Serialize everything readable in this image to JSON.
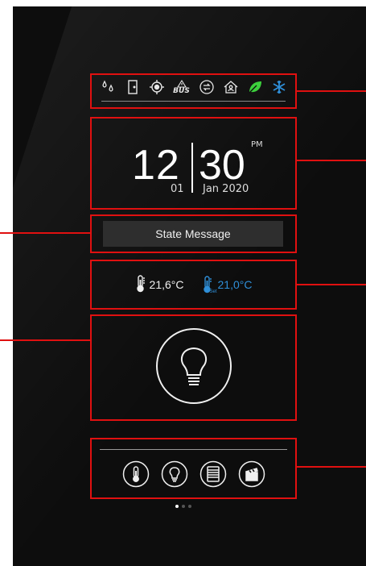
{
  "status_bar": {
    "icons": [
      "droplets-icon",
      "door-icon",
      "target-icon",
      "bus-warning-icon",
      "sync-icon",
      "home-person-icon",
      "leaf-icon",
      "snowflake-icon"
    ],
    "bus_label": "BUS",
    "leaf_color": "#3ccf3c",
    "snow_color": "#2f8fd8"
  },
  "clock": {
    "hours": "12",
    "minutes": "30",
    "ampm": "PM",
    "day": "01",
    "month_year": "Jan 2020"
  },
  "state": {
    "label": "State Message"
  },
  "temperature": {
    "current": "21,6°C",
    "setpoint": "21,0°C",
    "set_label": "Set",
    "setpoint_color": "#2f8fd8"
  },
  "light": {
    "icon": "lightbulb-icon"
  },
  "nav": {
    "items": [
      "thermometer-nav-icon",
      "lightbulb-nav-icon",
      "blinds-nav-icon",
      "scene-nav-icon"
    ],
    "page_count": 3,
    "active_page": 1
  },
  "colors": {
    "annotation": "#e01010",
    "panel": "#0d0d0d"
  }
}
